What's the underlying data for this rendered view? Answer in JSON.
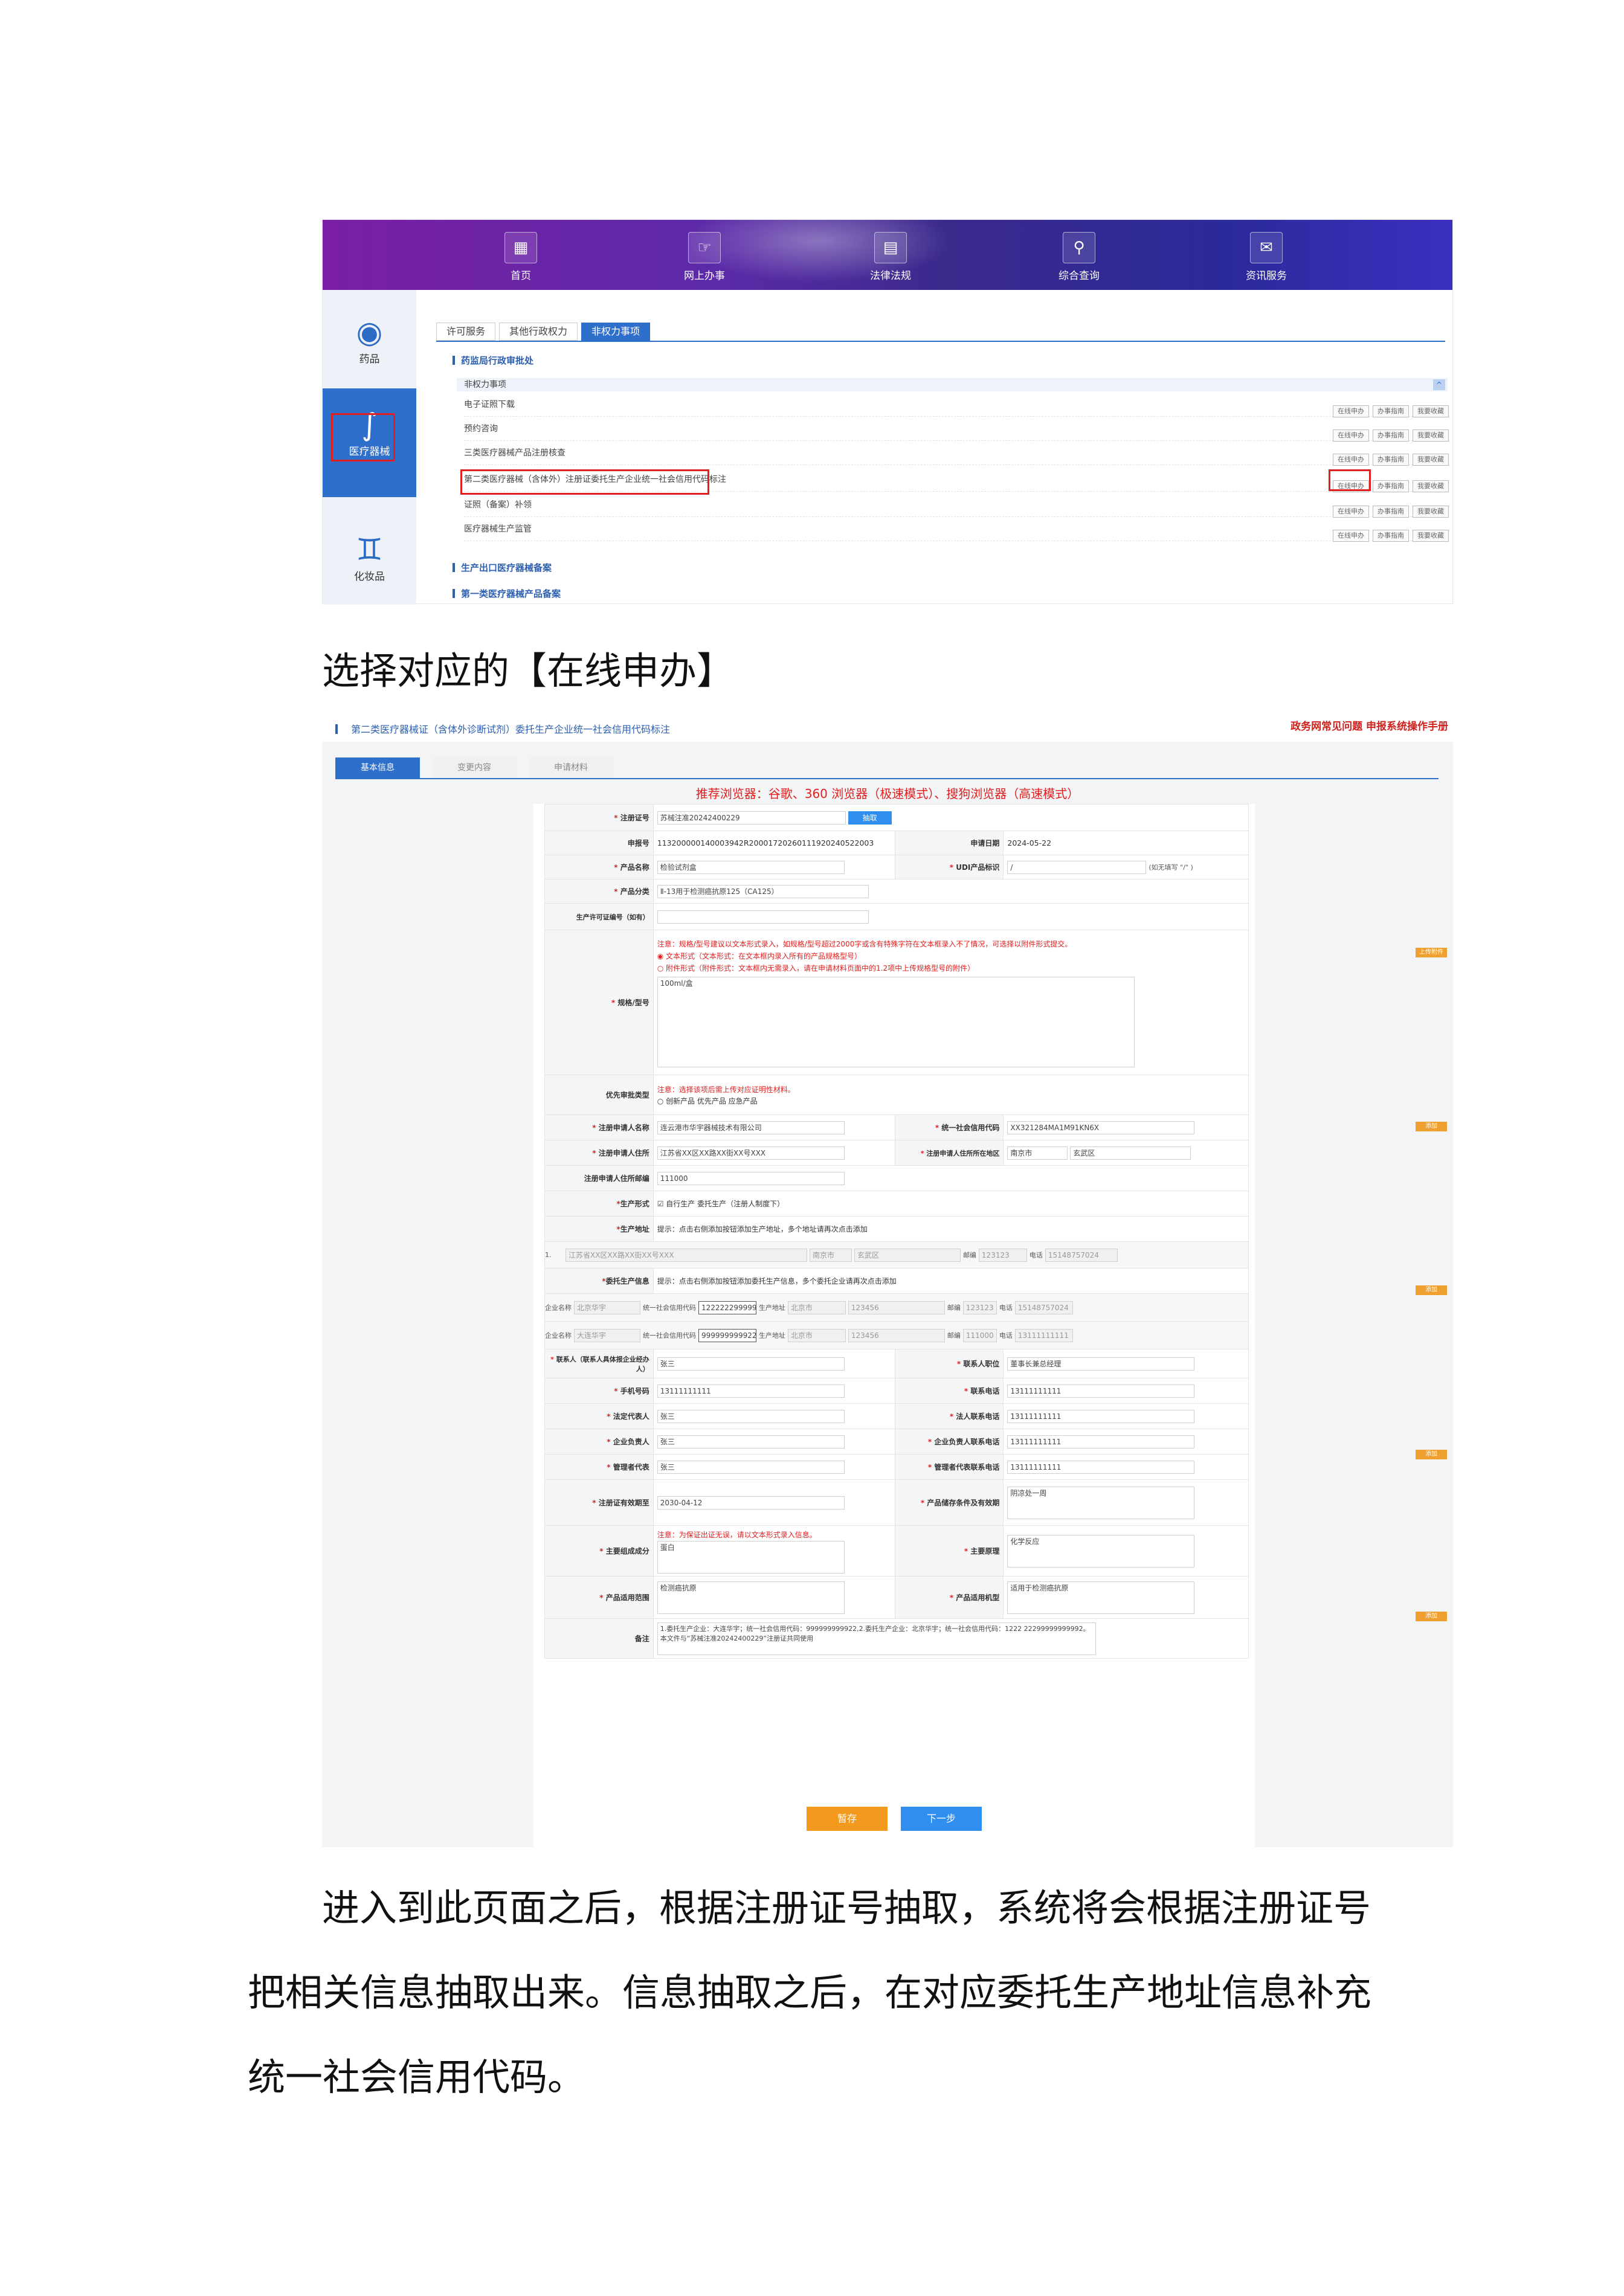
{
  "screenshot1": {
    "nav": [
      {
        "label": "首页",
        "icon": "building-icon"
      },
      {
        "label": "网上办事",
        "icon": "hand-icon"
      },
      {
        "label": "法律法规",
        "icon": "book-icon"
      },
      {
        "label": "综合查询",
        "icon": "search-icon"
      },
      {
        "label": "资讯服务",
        "icon": "chat-icon"
      }
    ],
    "sidebar": [
      {
        "label": "药品",
        "icon": "pill-icon"
      },
      {
        "label": "医疗器械",
        "icon": "stethoscope-icon"
      },
      {
        "label": "化妆品",
        "icon": "cosmetics-icon"
      }
    ],
    "tabs": [
      "许可服务",
      "其他行政权力",
      "非权力事项"
    ],
    "section_main": "药监局行政审批处",
    "subheader": "非权力事项",
    "rows": [
      "电子证照下载",
      "预约咨询",
      "三类医疗器械产品注册核查",
      "第二类医疗器械（含体外）注册证委托生产企业统一社会信用代码标注",
      "证照（备案）补领",
      "医疗器械生产监管"
    ],
    "row_buttons": [
      "在线申办",
      "办事指南",
      "我要收藏"
    ],
    "sections_bottom": [
      "生产出口医疗器械备案",
      "第一类医疗器械产品备案"
    ]
  },
  "caption1": "选择对应的【在线申办】",
  "screenshot2": {
    "title": "第二类医疗器械证（含体外诊断试剂）委托生产企业统一社会信用代码标注",
    "links": "政务网常见问题    申报系统操作手册",
    "tabs": [
      "基本信息",
      "变更内容",
      "申请材料"
    ],
    "recommend": "推荐浏览器：谷歌、360 浏览器（极速模式）、搜狗浏览器（高速模式）",
    "labels": {
      "reg_no": "注册证号",
      "apply_no": "申报号",
      "apply_date": "申请日期",
      "product_name": "产品名称",
      "udi": "UDI产品标识",
      "category": "产品分类",
      "license_no": "生产许可证编号（如有）",
      "spec": "规格/型号",
      "priority": "优先审批类型",
      "applicant_name": "注册申请人名称",
      "credit_code": "统一社会信用代码",
      "applicant_addr": "注册申请人住所",
      "applicant_region": "注册申请人住所所在地区",
      "postcode": "注册申请人住所邮编",
      "prod_form": "生产形式",
      "prod_addr": "生产地址",
      "entrust": "委托生产信息",
      "contact": "联系人（联系人具体报企业经办人）",
      "contact_role": "联系人职位",
      "mobile": "手机号码",
      "contact_phone": "联系电话",
      "legal_rep": "法定代表人",
      "legal_phone": "法人联系电话",
      "principal": "企业负责人",
      "principal_phone": "企业负责人联系电话",
      "mgr_rep": "管理者代表",
      "mgr_phone": "管理者代表联系电话",
      "valid_until": "注册证有效期至",
      "storage": "产品储存条件及有效期",
      "composition": "主要组成成分",
      "principle": "主要原理",
      "scope": "产品适用范围",
      "purpose": "产品适用机型",
      "remark": "备注"
    },
    "values": {
      "reg_no": "苏械注准20242400229",
      "extract_btn": "抽取",
      "apply_no": "113200000140003942R20001720260111920240522003",
      "apply_date": "2024-05-22",
      "product_name": "检验试剂盒",
      "udi": "/",
      "udi_hint": "(如无填写 \"/\" )",
      "category": "Ⅱ-13用于检测癌抗原125（CA125）",
      "spec_note": "注意：规格/型号建议以文本形式录入，如规格/型号超过2000字或含有特殊字符在文本框录入不了情况，可选择以附件形式提交。",
      "spec_opt1": "文本形式（文本形式：在文本框内录入所有的产品规格型号）",
      "spec_opt2": "附件形式（附件形式：文本框内无需录入，请在申请材料页面中的1.2项中上传规格型号的附件）",
      "spec_value": "100ml/盒",
      "priority_note": "注意：选择该项后需上传对应证明性材料。",
      "priority_opts": "创新产品   优先产品   应急产品",
      "applicant_name": "连云港市华宇器械技术有限公司",
      "credit_code": "XX321284MA1M91KN6X",
      "applicant_addr": "江苏省XX区XX路XX街XX号XXX",
      "region_city": "南京市",
      "region_district": "玄武区",
      "postcode": "111000",
      "prod_form_opts": "自行生产   委托生产（注册人制度下）",
      "prod_addr_hint": "提示：点击右侧添加按钮添加生产地址，多个地址请再次点击添加",
      "addr_idx": "1.",
      "addr1": "江苏省XX区XX路XX街XX号XXX",
      "addr1_city": "南京市",
      "addr1_district": "玄武区",
      "postcode_lbl": "邮编",
      "addr1_post": "123123",
      "phone_lbl": "电话",
      "addr1_phone": "15148757024",
      "entrust_hint": "提示：点击右侧添加按钮添加委托生产信息，多个委托企业请再次点击添加",
      "ent_name_lbl": "企业名称",
      "ent_code_lbl": "统一社会信用代码",
      "ent_addr_lbl": "生产地址",
      "ent1_name": "北京华宇",
      "ent1_code": "122222299999",
      "ent1_city": "北京市",
      "ent1_zip": "123456",
      "ent1_post": "123123",
      "ent1_phone": "15148757024",
      "ent2_name": "大连华宇",
      "ent2_code": "999999999922",
      "ent2_city": "北京市",
      "ent2_zip": "123456",
      "ent2_post": "111000",
      "ent2_phone": "13111111111",
      "contact": "张三",
      "contact_role": "董事长兼总经理",
      "mobile": "13111111111",
      "contact_phone": "13111111111",
      "legal_rep": "张三",
      "legal_phone": "13111111111",
      "principal": "张三",
      "principal_phone": "13111111111",
      "mgr_rep": "张三",
      "mgr_phone": "13111111111",
      "valid_until": "2030-04-12",
      "storage": "阴凉处一周",
      "composition_note": "注意：为保证出证无误，请以文本形式录入信息。",
      "composition": "蛋白",
      "principle": "化学反应",
      "scope": "检测癌抗原",
      "purpose": "适用于检测癌抗原",
      "remark": "1.委托生产企业：大连华宇；统一社会信用代码：999999999922,2.委托生产企业：北京华宇；统一社会信用代码：1222 22299999999992。本文件与“苏械注准20242400229”注册证共同使用",
      "save_btn": "暂存",
      "next_btn": "下一步",
      "side_btn1": "上传附件",
      "side_btn2": "添加"
    }
  },
  "para": [
    "进入到此页面之后，根据注册证号抽取，系统将会根据注册证号",
    "把相关信息抽取出来。信息抽取之后，在对应委托生产地址信息补充",
    "统一社会信用代码。"
  ]
}
